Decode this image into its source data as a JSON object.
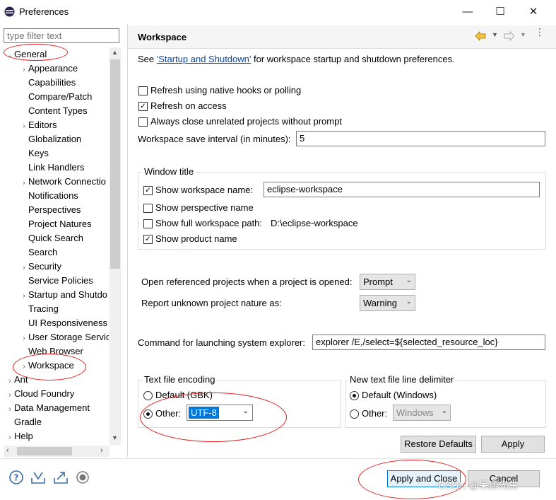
{
  "window": {
    "title": "Preferences",
    "min_glyph": "—",
    "max_glyph": "☐",
    "close_glyph": "✕"
  },
  "filter": {
    "placeholder": "type filter text"
  },
  "tree": {
    "general": "General",
    "items": [
      {
        "label": "Appearance",
        "chev": true
      },
      {
        "label": "Capabilities",
        "chev": false
      },
      {
        "label": "Compare/Patch",
        "chev": false
      },
      {
        "label": "Content Types",
        "chev": false
      },
      {
        "label": "Editors",
        "chev": true
      },
      {
        "label": "Globalization",
        "chev": false
      },
      {
        "label": "Keys",
        "chev": false
      },
      {
        "label": "Link Handlers",
        "chev": false
      },
      {
        "label": "Network Connectio",
        "chev": true
      },
      {
        "label": "Notifications",
        "chev": false
      },
      {
        "label": "Perspectives",
        "chev": false
      },
      {
        "label": "Project Natures",
        "chev": false
      },
      {
        "label": "Quick Search",
        "chev": false
      },
      {
        "label": "Search",
        "chev": false
      },
      {
        "label": "Security",
        "chev": true
      },
      {
        "label": "Service Policies",
        "chev": false
      },
      {
        "label": "Startup and Shutdo",
        "chev": true
      },
      {
        "label": "Tracing",
        "chev": false
      },
      {
        "label": "UI Responsiveness",
        "chev": false
      },
      {
        "label": "User Storage Servic",
        "chev": true
      },
      {
        "label": "Web Browser",
        "chev": false
      },
      {
        "label": "Workspace",
        "chev": true
      }
    ],
    "top_level": [
      "Ant",
      "Cloud Foundry",
      "Data Management",
      "Gradle",
      "Help"
    ]
  },
  "page": {
    "title": "Workspace",
    "intro_prefix": "See ",
    "intro_link": "'Startup and Shutdown'",
    "intro_suffix": " for workspace startup and shutdown preferences.",
    "refresh_native": "Refresh using native hooks or polling",
    "refresh_access": "Refresh on access",
    "always_close": "Always close unrelated projects without prompt",
    "save_interval_label": "Workspace save interval (in minutes):",
    "save_interval_value": "5",
    "window_title_group": "Window title",
    "show_ws_name": "Show workspace name:",
    "ws_name_value": "eclipse-workspace",
    "show_perspective": "Show perspective name",
    "show_full_path": "Show full workspace path:",
    "full_path_value": "D:\\eclipse-workspace",
    "show_product": "Show product name",
    "open_ref_label": "Open referenced projects when a project is opened:",
    "open_ref_value": "Prompt",
    "report_unknown_label": "Report unknown project nature as:",
    "report_unknown_value": "Warning",
    "cmd_label": "Command for launching system explorer:",
    "cmd_value": "explorer /E,/select=${selected_resource_loc}",
    "encoding_group": "Text file encoding",
    "enc_default": "Default (GBK)",
    "enc_other": "Other:",
    "enc_value": "UTF-8",
    "delim_group": "New text file line delimiter",
    "delim_default": "Default (Windows)",
    "delim_other": "Other:",
    "delim_value": "Windows",
    "restore_defaults": "Restore Defaults",
    "apply": "Apply"
  },
  "footer": {
    "apply_close": "Apply and Close",
    "cancel": "Cancel",
    "watermark": "CSDN @呆店先生"
  },
  "colors": {
    "annotation": "#e31c1c",
    "selection": "#0078d7"
  }
}
